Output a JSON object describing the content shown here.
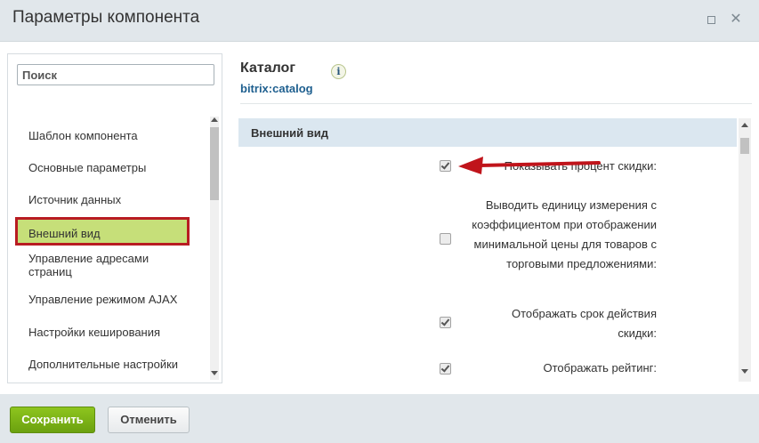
{
  "window": {
    "title": "Параметры компонента"
  },
  "sidebar": {
    "search_placeholder": "Поиск",
    "items": [
      {
        "label": "Шаблон компонента",
        "active": false
      },
      {
        "label": "Основные параметры",
        "active": false
      },
      {
        "label": "Источник данных",
        "active": false
      },
      {
        "label": "Внешний вид",
        "active": true
      },
      {
        "label": "Управление адресами страниц",
        "active": false
      },
      {
        "label": "Управление режимом AJAX",
        "active": false
      },
      {
        "label": "Настройки кеширования",
        "active": false
      },
      {
        "label": "Дополнительные настройки",
        "active": false
      }
    ]
  },
  "main": {
    "heading": "Каталог",
    "subheading": "bitrix:catalog",
    "info_icon": "i",
    "section_title": "Внешний вид",
    "params": [
      {
        "label": "Показывать процент скидки:",
        "checked": true
      },
      {
        "label": "Выводить единицу измерения с коэффициентом при отображении минимальной цены для товаров с торговыми предложениями:",
        "checked": false
      },
      {
        "label": "Отображать срок действия скидки:",
        "checked": true
      },
      {
        "label": "Отображать рейтинг:",
        "checked": true
      }
    ]
  },
  "footer": {
    "save_label": "Сохранить",
    "cancel_label": "Отменить"
  },
  "colors": {
    "highlight_fill": "#c6df79",
    "highlight_border": "#b81c22",
    "arrow": "#c0141b",
    "save_button": "#7cb518"
  },
  "icons": [
    "maximize-icon",
    "close-icon",
    "info-icon",
    "checkbox-icon",
    "red-arrow-annotation"
  ]
}
